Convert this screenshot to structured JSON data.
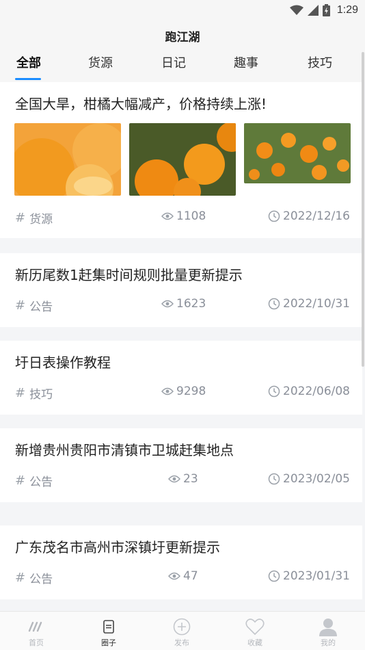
{
  "status_bar": {
    "time": "1:29"
  },
  "header": {
    "title": "跑江湖"
  },
  "tabs": [
    {
      "label": "全部",
      "active": true
    },
    {
      "label": "货源"
    },
    {
      "label": "日记"
    },
    {
      "label": "趣事"
    },
    {
      "label": "技巧"
    }
  ],
  "posts": [
    {
      "title": "全国大旱，柑橘大幅减产，价格持续上涨!",
      "tag": "货源",
      "views": "1108",
      "date": "2022/12/16",
      "has_images": true
    },
    {
      "title": "新历尾数1赶集时间规则批量更新提示",
      "tag": "公告",
      "views": "1623",
      "date": "2022/10/31"
    },
    {
      "title": "圩日表操作教程",
      "tag": "技巧",
      "views": "9298",
      "date": "2022/06/08"
    },
    {
      "title": "新增贵州贵阳市清镇市卫城赶集地点",
      "tag": "公告",
      "views": "23",
      "date": "2023/02/05"
    },
    {
      "title": "广东茂名市高州市深镇圩更新提示",
      "tag": "公告",
      "views": "47",
      "date": "2023/01/31"
    }
  ],
  "bottom_nav": [
    {
      "label": "首页",
      "icon": "home-icon"
    },
    {
      "label": "圈子",
      "icon": "circle-doc-icon",
      "active": true
    },
    {
      "label": "发布",
      "icon": "plus-circle-icon"
    },
    {
      "label": "收藏",
      "icon": "heart-icon"
    },
    {
      "label": "我的",
      "icon": "user-icon"
    }
  ],
  "colors": {
    "accent": "#1a8cff",
    "meta": "#8a8f99",
    "background": "#f4f5f7"
  }
}
